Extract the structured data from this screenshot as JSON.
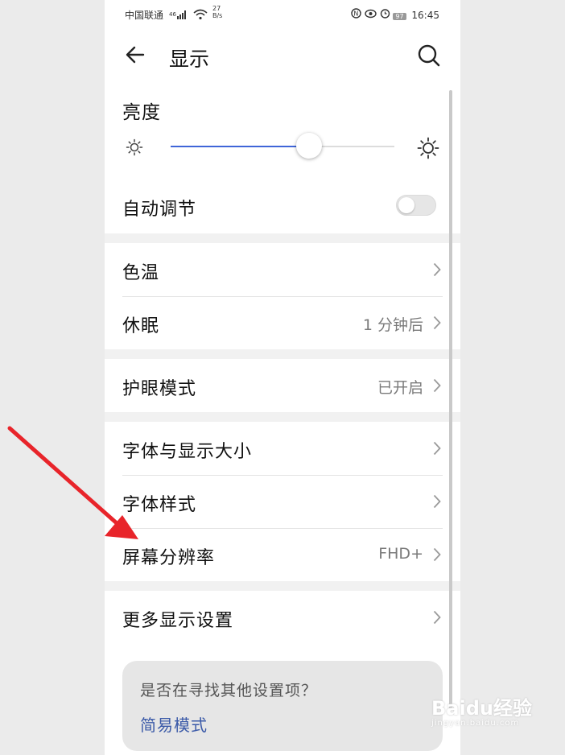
{
  "status_bar": {
    "carrier": "中国联通",
    "speed_value": "27",
    "speed_unit": "B/s",
    "battery": "97",
    "time": "16:45"
  },
  "header": {
    "title": "显示"
  },
  "brightness": {
    "label": "亮度",
    "level_percent": 62
  },
  "auto_adjust": {
    "label": "自动调节",
    "enabled": false
  },
  "group1": [
    {
      "label": "色温",
      "value": ""
    },
    {
      "label": "休眠",
      "value": "1 分钟后"
    }
  ],
  "group2": [
    {
      "label": "护眼模式",
      "value": "已开启"
    }
  ],
  "group3": [
    {
      "label": "字体与显示大小",
      "value": ""
    },
    {
      "label": "字体样式",
      "value": ""
    },
    {
      "label": "屏幕分辨率",
      "value": "FHD+"
    }
  ],
  "group4": [
    {
      "label": "更多显示设置",
      "value": ""
    }
  ],
  "hint": {
    "question": "是否在寻找其他设置项？",
    "link": "简易模式"
  },
  "watermark": {
    "brand": "Baidu经验",
    "url": "jingyan.baidu.com"
  },
  "colors": {
    "accent": "#3f65d8",
    "annotation_arrow": "#e8242a",
    "link": "#3b5aa8"
  }
}
